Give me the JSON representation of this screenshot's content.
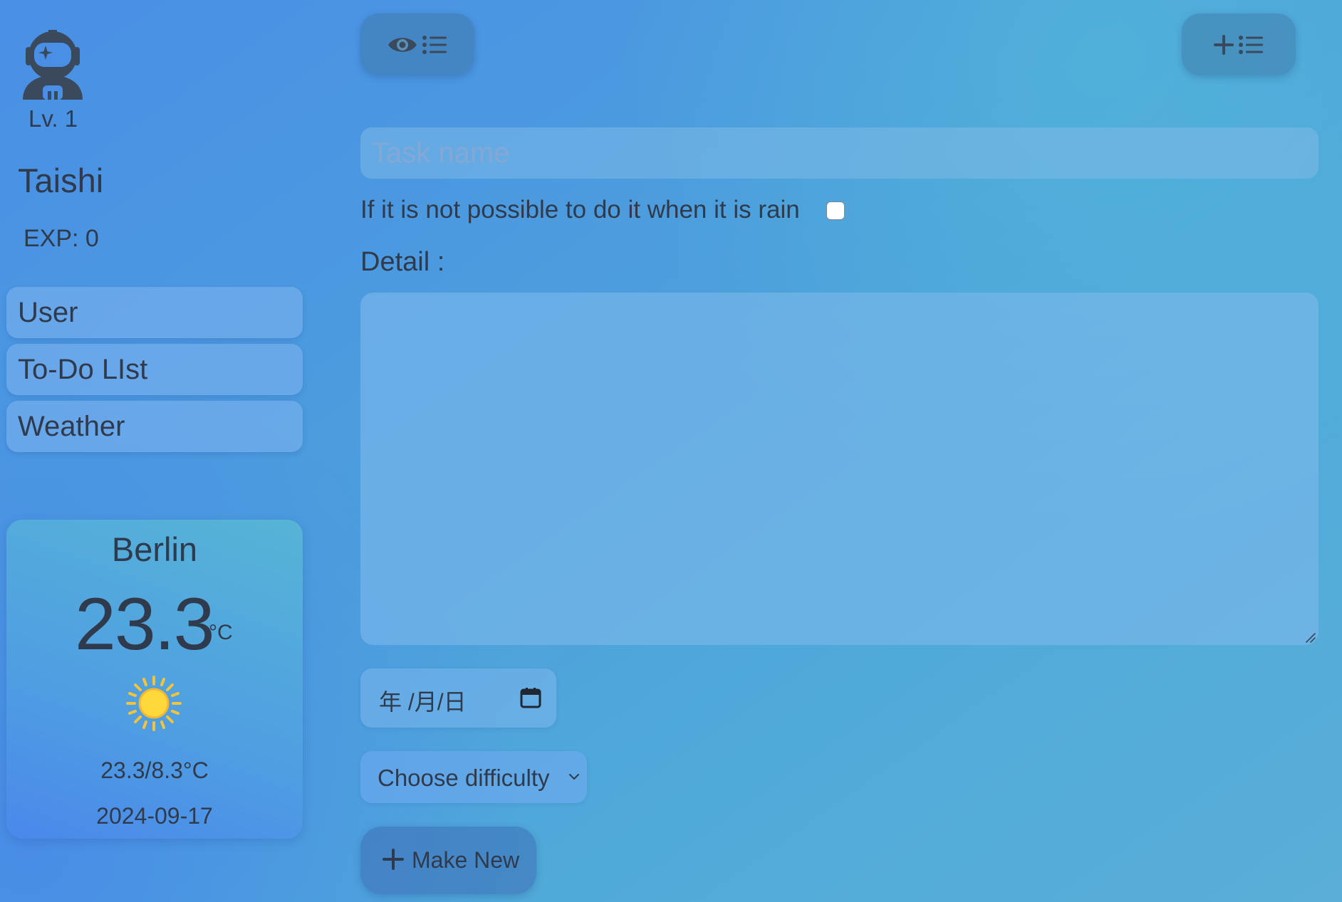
{
  "profile": {
    "level": "Lv. 1",
    "name": "Taishi",
    "exp": "EXP: 0"
  },
  "nav": {
    "items": [
      {
        "label": "User"
      },
      {
        "label": "To-Do LIst"
      },
      {
        "label": "Weather"
      }
    ]
  },
  "weather": {
    "city": "Berlin",
    "temperature": "23.3",
    "unit": "°C",
    "condition_icon": "sun-icon",
    "range": "23.3/8.3°C",
    "date": "2024-09-17"
  },
  "toolbar": {
    "view_list_icon": "eye-list-icon",
    "add_list_icon": "plus-list-icon"
  },
  "form": {
    "task_placeholder": "Task name",
    "task_value": "",
    "rain_label": "If it is not possible to do it when it is rain",
    "rain_checked": false,
    "detail_label": "Detail :",
    "detail_value": "",
    "date_placeholder": "年 /月/日",
    "difficulty_selected": "Choose difficulty",
    "make_new_label": "Make New"
  },
  "colors": {
    "text": "#2f3b4c",
    "background_start": "#4a8fe6",
    "background_end": "#5aaed8"
  }
}
